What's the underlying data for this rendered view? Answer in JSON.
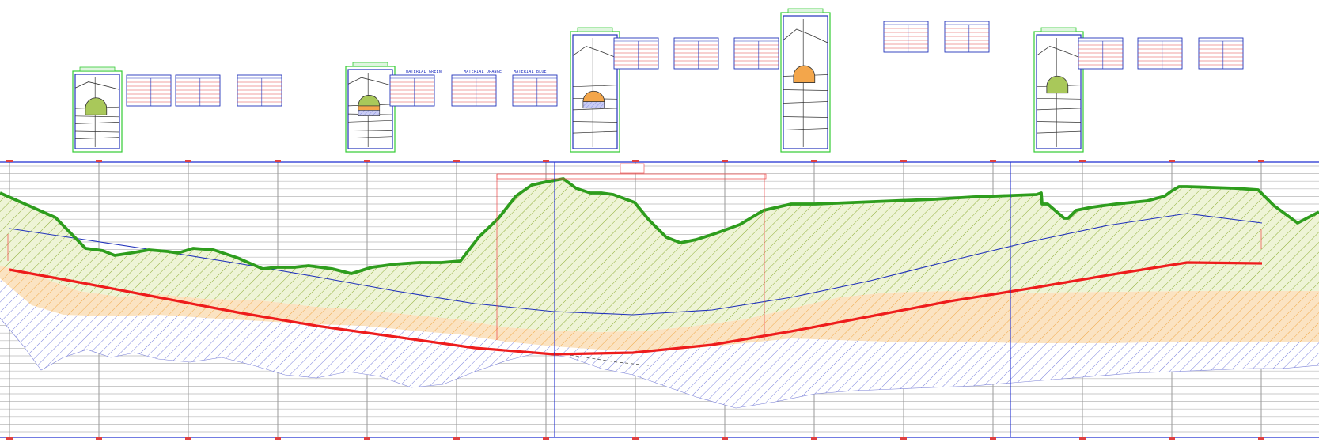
{
  "drawing": {
    "material_notes": [
      "MATERIAL GREEN",
      "MATERIAL ORANGE",
      "MATERIAL BLUE"
    ]
  },
  "sections": [
    {
      "id": "s1",
      "label": "",
      "has_tables": true
    },
    {
      "id": "s2",
      "label": "",
      "has_tables": true
    },
    {
      "id": "s3",
      "label": "",
      "has_tables": true
    },
    {
      "id": "s4",
      "label": "",
      "has_tables": true
    },
    {
      "id": "s5",
      "label": "",
      "has_tables": true
    }
  ],
  "profile": {
    "ground_color": "#2e9d1d",
    "design_line_color": "#ee1c1c",
    "blue_line_color": "#2233bb",
    "hatch_green": "#8fae3a",
    "hatch_orange": "#f0a94a",
    "hatch_blue": "#6c74d8",
    "grid_color": "#b8b8b8",
    "frame_color": "#1f2fd0",
    "section_box_color": "#33cc33"
  },
  "colors": {
    "fill_green": "#a9c85a",
    "fill_orange": "#f3a64b",
    "fill_blue": "#b9bdf2"
  }
}
